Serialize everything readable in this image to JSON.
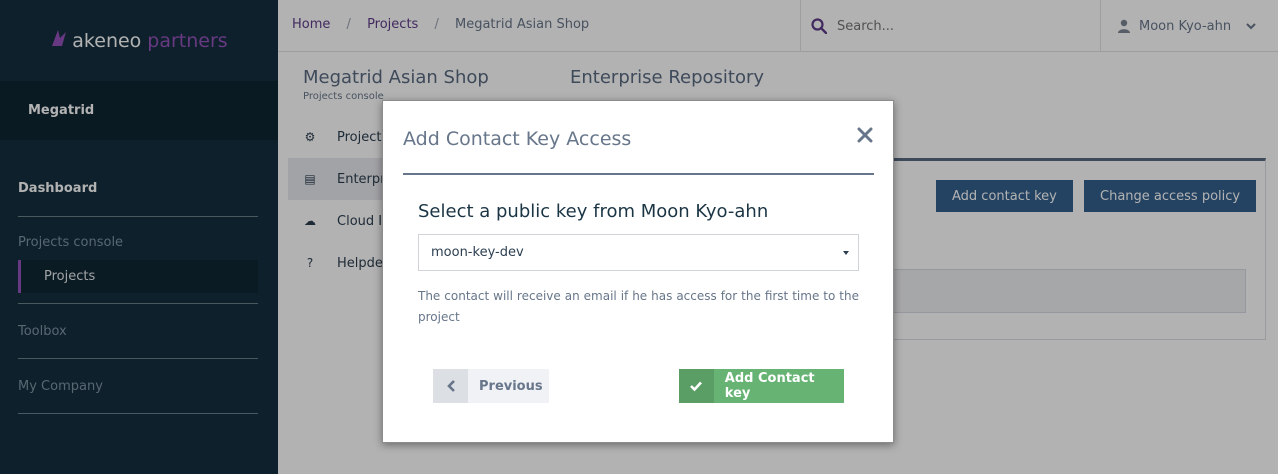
{
  "sidebar": {
    "logo": {
      "brand": "akeneo",
      "suffix": "partners"
    },
    "company": "Megatrid",
    "dashboard": "Dashboard",
    "projects_console": {
      "title": "Projects console",
      "items": [
        "Projects"
      ]
    },
    "toolbox": "Toolbox",
    "my_company": "My Company"
  },
  "topbar": {
    "breadcrumb": [
      "Home",
      "Projects",
      "Megatrid Asian Shop"
    ],
    "breadcrumb_sep": "/",
    "search_placeholder": "Search...",
    "user_name": "Moon Kyo-ahn"
  },
  "project_panel": {
    "title": "Megatrid Asian Shop",
    "subtitle": "Projects console",
    "menu": [
      {
        "label": "Project",
        "icon": "gears-icon"
      },
      {
        "label": "Enterprise Repository",
        "icon": "file-icon"
      },
      {
        "label": "Cloud Instances",
        "icon": "cloud-icon"
      },
      {
        "label": "Helpdesk",
        "icon": "question-icon"
      }
    ]
  },
  "main": {
    "title": "Enterprise Repository",
    "add_contact_key": "Add contact key",
    "change_access_policy": "Change access policy"
  },
  "modal": {
    "title": "Add Contact Key Access",
    "subtitle": "Select a public key from Moon Kyo-ahn",
    "selected_key": "moon-key-dev",
    "help_text": "The contact will receive an email if he has access for the first time to the project",
    "previous_label": "Previous",
    "add_label": "Add Contact key"
  },
  "colors": {
    "sidebar_bg": "#142f3e",
    "accent_purple": "#9452ba",
    "primary_blue": "#34618e",
    "success_green": "#67b373"
  }
}
